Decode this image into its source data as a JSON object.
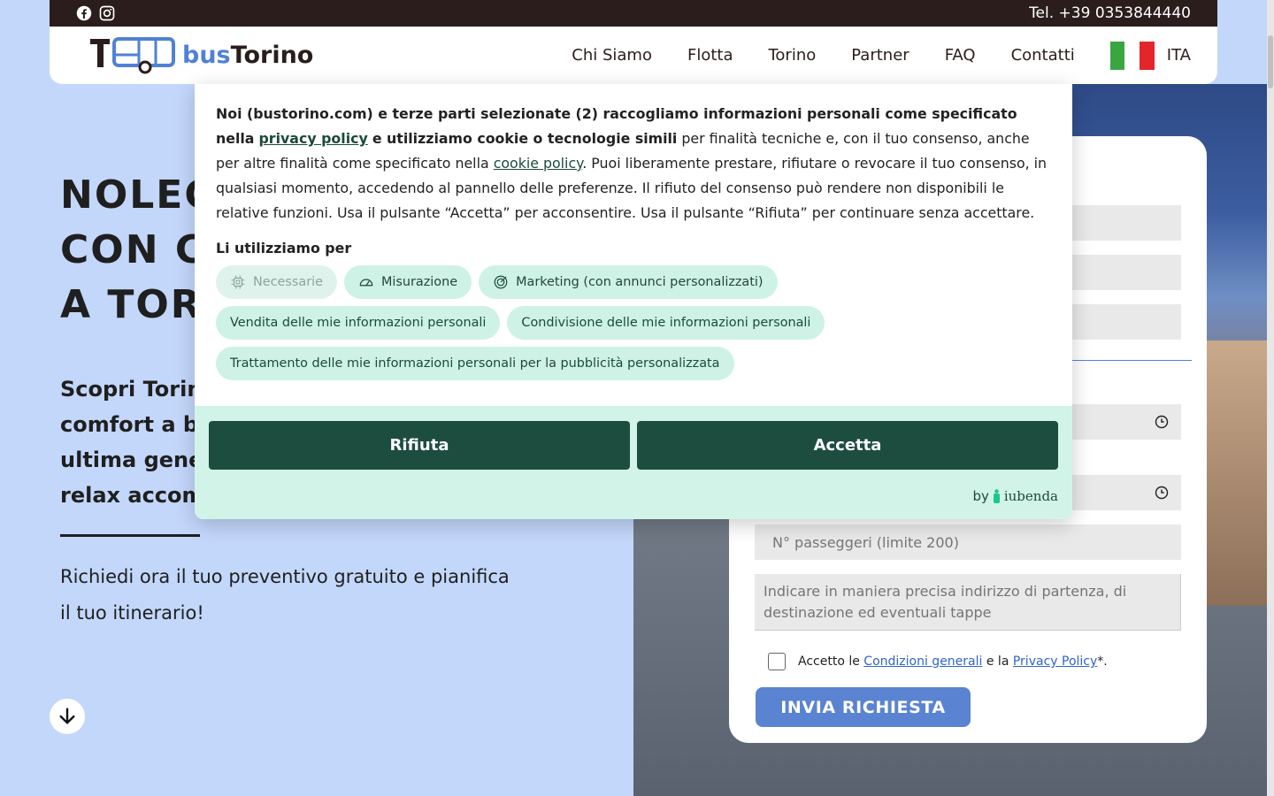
{
  "topbar": {
    "phone": "Tel. +39 0353844440",
    "social": [
      "facebook-icon",
      "instagram-icon"
    ]
  },
  "header": {
    "brand_prefix": "bus",
    "brand_suffix": "Torino",
    "nav": [
      "Chi Siamo",
      "Flotta",
      "Torino",
      "Partner",
      "FAQ",
      "Contatti"
    ],
    "language": "ITA"
  },
  "hero": {
    "title_lines": [
      "NOLEG",
      "CON C",
      "A TORI"
    ],
    "subtitle_lines": [
      "Scopri Torin",
      "comfort a b",
      "ultima gener",
      "relax accom"
    ],
    "cta_line1": "Richiedi ora il tuo preventivo gratuito e pianifica",
    "cta_line2": "il tuo itinerario!"
  },
  "form": {
    "passengers_placeholder": "N° passeggeri (limite 200)",
    "route_placeholder": "Indicare in maniera precisa indirizzo di partenza, di destinazione ed eventuali tappe",
    "consent_prefix": "Accetto le",
    "terms_link": "Condizioni generali",
    "consent_middle": "e la",
    "privacy_link": "Privacy Policy",
    "consent_suffix": "*.",
    "submit": "INVIA RICHIESTA"
  },
  "cookie": {
    "p1_bold": "Noi (bustorino.com) e terze parti selezionate (2) raccogliamo informazioni personali come specificato nella",
    "privacy_link": "privacy policy",
    "p1_bold2": "e utilizziamo cookie o tecnologie simili",
    "p1_rest": "per finalità tecniche e, con il tuo consenso, anche per altre finalità come specificato nella",
    "cookie_link": "cookie policy",
    "p1_end": ". Puoi liberamente prestare, rifiutare o revocare il tuo consenso, in qualsiasi momento, accedendo al pannello delle preferenze. Il rifiuto del consenso può rendere non disponibili le relative funzioni. Usa il pulsante “Accetta” per acconsentire. Usa il pulsante “Rifiuta” per continuare senza accettare.",
    "heading": "Li utilizziamo per",
    "chips": {
      "necessary": "Necessarie",
      "measurement": "Misurazione",
      "marketing": "Marketing (con annunci personalizzati)",
      "sale": "Vendita delle mie informazioni personali",
      "sharing": "Condivisione delle mie informazioni personali",
      "processing": "Trattamento delle mie informazioni personali per la pubblicità personalizzata"
    },
    "reject": "Rifiuta",
    "accept": "Accetta",
    "by": "by",
    "iubenda": "iubenda"
  },
  "colors": {
    "accent": "#4f82d6",
    "cookie_dark": "#1d4d3e",
    "cookie_light": "#d2f4e8",
    "topbar": "#2a1d1c"
  }
}
